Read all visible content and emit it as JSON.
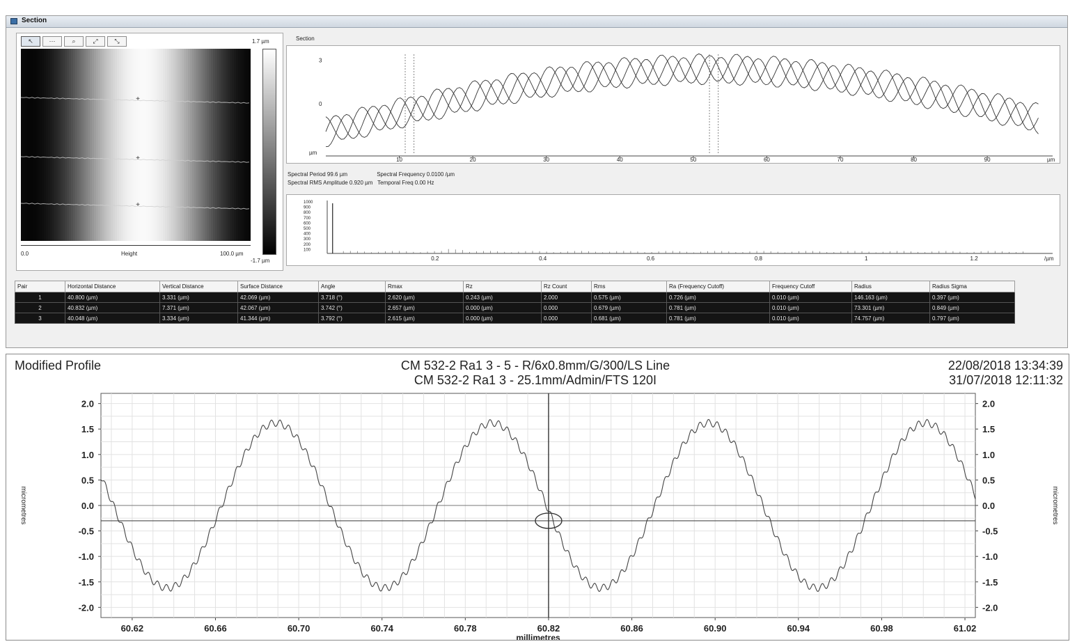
{
  "section_window": {
    "title": "Section",
    "toolbar": [
      "↖",
      "⋯",
      "⌕",
      "⤢",
      "⤡"
    ],
    "image_panel": {
      "colorbar_max": "1.7 µm",
      "colorbar_min": "-1.7 µm",
      "axis_start": "0.0",
      "axis_label": "Height",
      "axis_end": "100.0 µm"
    },
    "section_plot": {
      "title": "Section",
      "y_ticks": [
        "3",
        "0"
      ],
      "y_unit": "µm",
      "x_ticks": [
        "10",
        "20",
        "30",
        "40",
        "50",
        "60",
        "70",
        "80",
        "90"
      ],
      "x_unit": "µm"
    },
    "spectral_info": {
      "period": "Spectral Period 99.6 µm",
      "frequency": "Spectral Frequency 0.0100 /µm",
      "rms_amplitude": "Spectral RMS Amplitude 0.920 µm",
      "temporal_freq": "Temporal Freq 0.00 Hz"
    },
    "spectral_plot": {
      "y_ticks": [
        "1000",
        "900",
        "800",
        "700",
        "600",
        "500",
        "400",
        "300",
        "200",
        "100"
      ],
      "x_ticks": [
        "0.2",
        "0.4",
        "0.6",
        "0.8",
        "1",
        "1.2"
      ],
      "x_unit": "/µm"
    },
    "table": {
      "columns": [
        "Pair",
        "Horizontal Distance",
        "Vertical Distance",
        "Surface Distance",
        "Angle",
        "Rmax",
        "Rz",
        "Rz Count",
        "Rms",
        "Ra (Frequency Cutoff)",
        "Frequency Cutoff",
        "Radius",
        "Radius Sigma"
      ],
      "rows": [
        [
          "1",
          "40.800 (µm)",
          "3.331 (µm)",
          "42.069 (µm)",
          "3.718 (°)",
          "2.620 (µm)",
          "0.243 (µm)",
          "2.000",
          "0.575 (µm)",
          "0.726 (µm)",
          "0.010 (µm)",
          "146.163 (µm)",
          "0.397 (µm)"
        ],
        [
          "2",
          "40.832 (µm)",
          "7.371 (µm)",
          "42.067 (µm)",
          "3.742 (°)",
          "2.657 (µm)",
          "0.000 (µm)",
          "0.000",
          "0.679 (µm)",
          "0.781 (µm)",
          "0.010 (µm)",
          "73.301 (µm)",
          "0.849 (µm)"
        ],
        [
          "3",
          "40.048 (µm)",
          "3.334 (µm)",
          "41.344 (µm)",
          "3.792 (°)",
          "2.615 (µm)",
          "0.000 (µm)",
          "0.000",
          "0.681 (µm)",
          "0.781 (µm)",
          "0.010 (µm)",
          "74.757 (µm)",
          "0.797 (µm)"
        ]
      ]
    }
  },
  "profile": {
    "title": "Modified Profile",
    "subtitle_line1": "CM 532-2 Ra1 3 - 5 - R/6x0.8mm/G/300/LS Line",
    "subtitle_line2": "CM 532-2 Ra1 3 - 25.1mm/Admin/FTS 120I",
    "datetime_line1": "22/08/2018 13:34:39",
    "datetime_line2": "31/07/2018 12:11:32",
    "xlabel": "millimetres",
    "ylabel": "micrometres"
  },
  "chart_data": {
    "type": "line",
    "title": "Modified Profile",
    "xlabel": "millimetres",
    "ylabel": "micrometres",
    "xlim": [
      60.605,
      61.025
    ],
    "ylim": [
      -2.2,
      2.2
    ],
    "x_ticks": [
      "60.62",
      "60.66",
      "60.70",
      "60.74",
      "60.78",
      "60.82",
      "60.86",
      "60.90",
      "60.94",
      "60.98",
      "61.02"
    ],
    "y_ticks": [
      "2.0",
      "1.5",
      "1.0",
      "0.5",
      "0.0",
      "-0.5",
      "-1.0",
      "-1.5",
      "-2.0"
    ],
    "grid": true,
    "series": [
      {
        "waveform": "sinusoid with superimposed ripple",
        "amplitude": 1.62,
        "period_mm": 0.104,
        "peak_x": [
          60.689,
          60.793,
          60.896,
          61.0
        ],
        "trough_x": [
          60.637,
          60.741,
          60.844,
          60.948
        ],
        "ripple_amplitude": 0.07,
        "ripple_period_mm": 0.0042
      }
    ],
    "cursor": {
      "x": 60.82,
      "y": -0.3
    }
  }
}
